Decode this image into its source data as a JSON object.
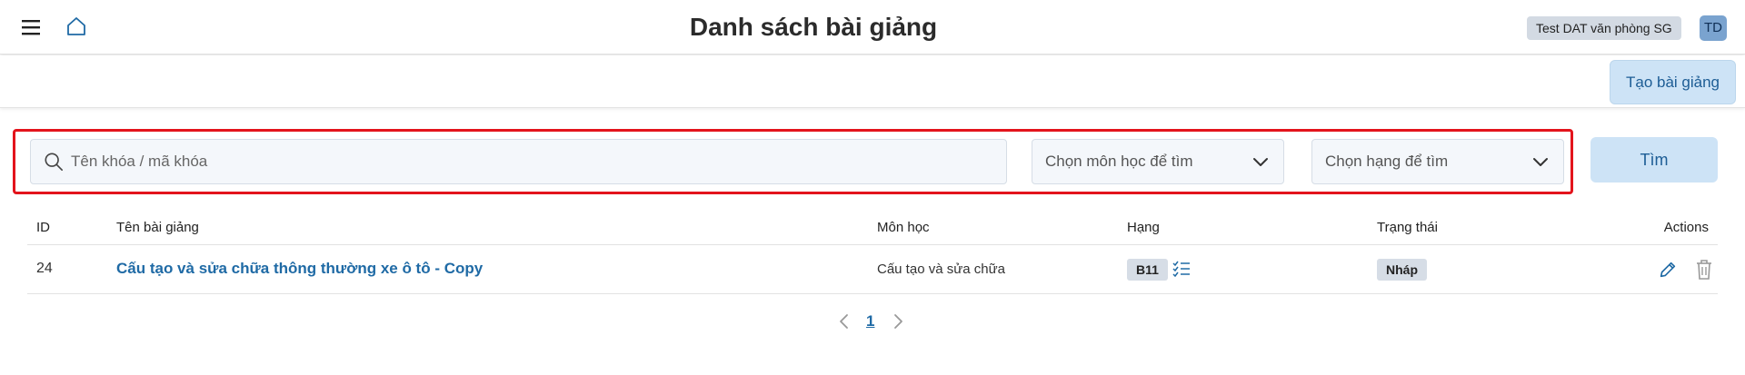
{
  "header": {
    "title": "Danh sách bài giảng",
    "organization": "Test DAT văn phòng SG",
    "avatar_initials": "TD"
  },
  "toolbar": {
    "create_label": "Tạo bài giảng"
  },
  "filters": {
    "search_placeholder": "Tên khóa / mã khóa",
    "search_value": "",
    "subject_select": "Chọn môn học để tìm",
    "rank_select": "Chọn hạng để tìm",
    "find_label": "Tìm"
  },
  "table": {
    "columns": {
      "id": "ID",
      "name": "Tên bài giảng",
      "subject": "Môn học",
      "rank": "Hạng",
      "status": "Trạng thái",
      "actions": "Actions"
    },
    "rows": [
      {
        "id": "24",
        "name": "Cấu tạo và sửa chữa thông thường xe ô tô - Copy",
        "subject": "Cấu tạo và sửa chữa",
        "rank": "B11",
        "status": "Nháp"
      }
    ]
  },
  "pagination": {
    "current_page": "1"
  },
  "colors": {
    "accent": "#1f6aa5",
    "button_bg": "#cde3f6",
    "highlight_border": "#e3141c"
  },
  "icons": {
    "menu": "hamburger-icon",
    "home": "home-icon",
    "search": "search-icon",
    "dropdown": "chevron-down-icon",
    "rank_list": "checklist-icon",
    "edit": "pencil-icon",
    "delete": "trash-icon",
    "prev": "chevron-left-icon",
    "next": "chevron-right-icon"
  }
}
